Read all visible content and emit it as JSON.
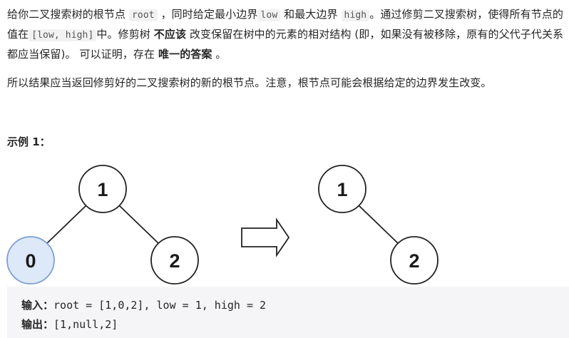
{
  "problem": {
    "p1": {
      "t1": "给你二叉搜索树的根节点 ",
      "c1": "root",
      "t2": " ，同时给定最小边界",
      "c2": "low",
      "t3": " 和最大边界 ",
      "c3": "high",
      "t4": "。通过修剪二叉搜索树，使得所有节点的值在",
      "c4": "[low, high]",
      "t5": "中。修剪树 ",
      "b1": "不应该",
      "t6": " 改变保留在树中的元素的相对结构 (即，如果没有被移除，原有的父代子代关系都应当保留)。 可以证明，存在 ",
      "b2": "唯一的答案",
      "t7": " 。"
    },
    "p2": "所以结果应当返回修剪好的二叉搜索树的新的根节点。注意，根节点可能会根据给定的边界发生改变。"
  },
  "example": {
    "title": "示例 1：",
    "before_tree": {
      "root": "1",
      "left": "0",
      "right": "2",
      "removed": "0"
    },
    "after_tree": {
      "root": "1",
      "right": "2"
    },
    "colors": {
      "node_fill": "#ffffff",
      "removed_fill": "#dde8f8",
      "removed_stroke": "#7d9fd6",
      "stroke": "#222222"
    },
    "input_label": "输入：",
    "input_value": "root = [1,0,2], low = 1, high = 2",
    "output_label": "输出：",
    "output_value": "[1,null,2]"
  }
}
